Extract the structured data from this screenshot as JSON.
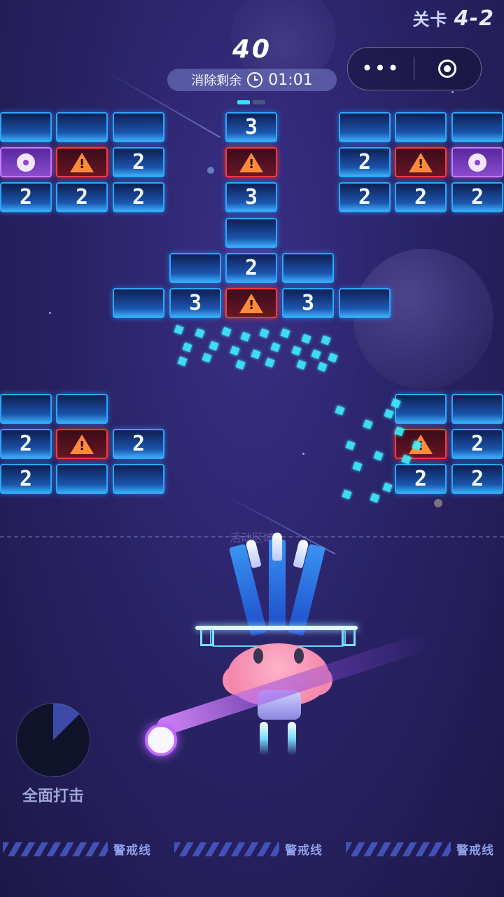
{
  "hud": {
    "level_prefix": "关卡",
    "level_number": "4-2",
    "score": "40",
    "remaining_label": "消除剩余",
    "timer": "01:01",
    "stage_progress": {
      "current": 1,
      "total": 2
    },
    "menu_more": "•••"
  },
  "bricks": [
    {
      "type": "plain",
      "label": ""
    },
    {
      "type": "plain",
      "label": ""
    },
    {
      "type": "plain",
      "label": ""
    },
    {
      "type": "number",
      "label": "3"
    },
    {
      "type": "plain",
      "label": ""
    },
    {
      "type": "plain",
      "label": ""
    },
    {
      "type": "plain",
      "label": ""
    },
    {
      "type": "nuke",
      "label": ""
    },
    {
      "type": "danger",
      "label": ""
    },
    {
      "type": "number",
      "label": "2"
    },
    {
      "type": "danger",
      "label": ""
    },
    {
      "type": "number",
      "label": "2"
    },
    {
      "type": "danger",
      "label": ""
    },
    {
      "type": "nuke",
      "label": ""
    },
    {
      "type": "number",
      "label": "2"
    },
    {
      "type": "number",
      "label": "2"
    },
    {
      "type": "number",
      "label": "2"
    },
    {
      "type": "number",
      "label": "3"
    },
    {
      "type": "number",
      "label": "2"
    },
    {
      "type": "number",
      "label": "2"
    },
    {
      "type": "number",
      "label": "2"
    },
    {
      "type": "plain",
      "label": ""
    },
    {
      "type": "plain",
      "label": ""
    },
    {
      "type": "number",
      "label": "2"
    },
    {
      "type": "plain",
      "label": ""
    },
    {
      "type": "plain",
      "label": ""
    },
    {
      "type": "number",
      "label": "3"
    },
    {
      "type": "danger",
      "label": ""
    },
    {
      "type": "number",
      "label": "3"
    },
    {
      "type": "plain",
      "label": ""
    },
    {
      "type": "plain",
      "label": ""
    },
    {
      "type": "plain",
      "label": ""
    },
    {
      "type": "number",
      "label": "2"
    },
    {
      "type": "danger",
      "label": ""
    },
    {
      "type": "number",
      "label": "2"
    },
    {
      "type": "number",
      "label": "2"
    },
    {
      "type": "plain",
      "label": ""
    },
    {
      "type": "plain",
      "label": ""
    },
    {
      "type": "plain",
      "label": ""
    },
    {
      "type": "plain",
      "label": ""
    },
    {
      "type": "danger",
      "label": ""
    },
    {
      "type": "number",
      "label": "2"
    },
    {
      "type": "number",
      "label": "2"
    },
    {
      "type": "number",
      "label": "2"
    }
  ],
  "play_area": {
    "zone_label": "活动区域"
  },
  "skill": {
    "label": "全面打击",
    "cooldown_fraction": 0.125
  },
  "warning_line": {
    "label": "警戒线"
  },
  "colors": {
    "brick_border": "#2aa8ff",
    "danger_border": "#ff3b3b",
    "nuke_border": "#c77bff",
    "ball_glow": "#c06bff",
    "particle": "#3ff0ff"
  }
}
